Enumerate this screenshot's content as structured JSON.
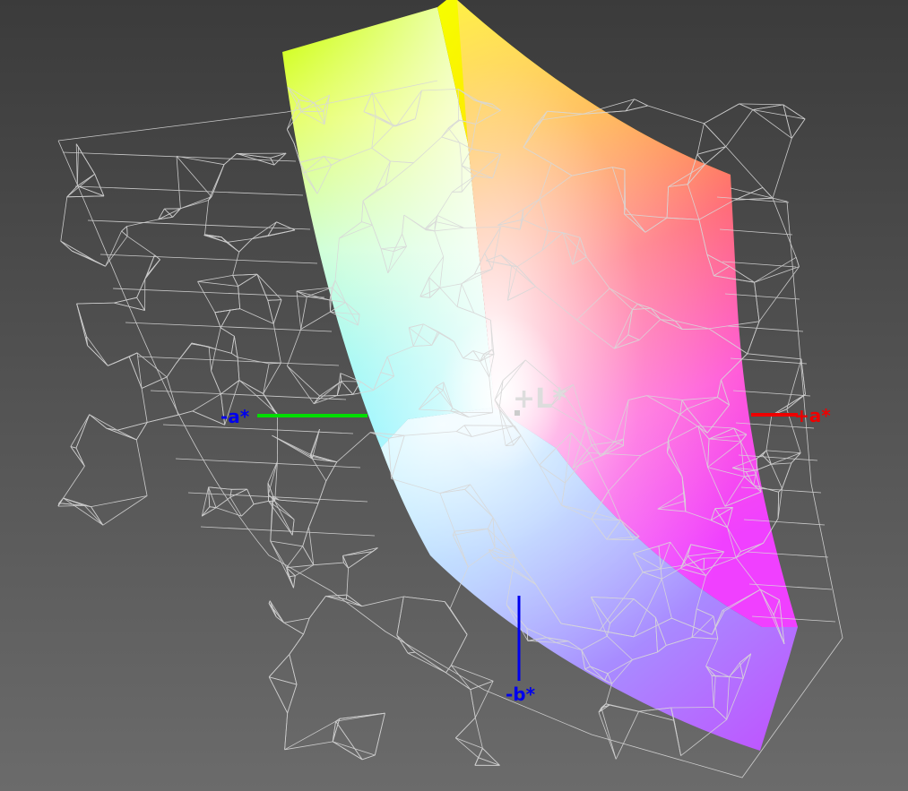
{
  "axes": {
    "plus_l": "+L*",
    "minus_a": "-a*",
    "plus_a": "+a*",
    "minus_b": "-b*"
  },
  "colors": {
    "background_top": "#3a3a3a",
    "background_bottom": "#6a6a6a",
    "wire": "#d8d8d8",
    "axis_green": "#00dd00",
    "axis_red": "#ee0000",
    "axis_blue": "#0000ee",
    "label_white": "#dddddd"
  },
  "icons": {
    "gamut_solid": "color-gamut-solid",
    "wireframe": "reference-gamut-wireframe"
  }
}
